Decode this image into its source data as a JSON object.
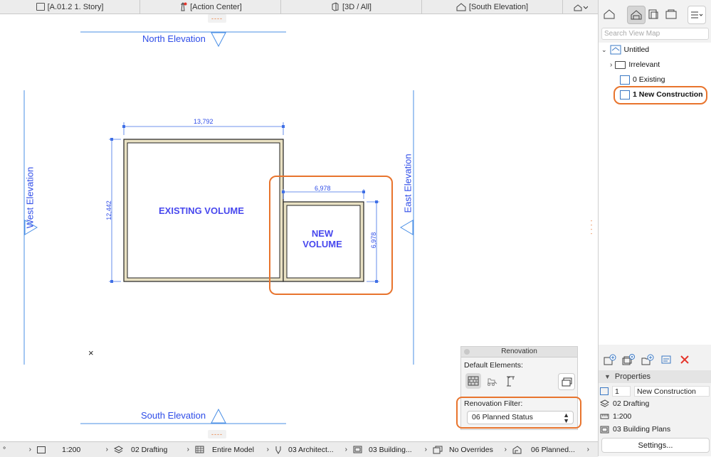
{
  "tabs": [
    {
      "label": "[A.01.2 1. Story]",
      "icon": "floor-plan-icon"
    },
    {
      "label": "[Action Center]",
      "icon": "lighthouse-icon"
    },
    {
      "label": "[3D / All]",
      "icon": "cube-icon"
    },
    {
      "label": "[South Elevation]",
      "icon": "house-elevation-icon"
    }
  ],
  "drawing": {
    "north_label": "North Elevation",
    "south_label": "South Elevation",
    "west_label": "West Elevation",
    "east_label": "East Elevation",
    "dim_top": "13,792",
    "dim_left": "12,442",
    "dim_new_top": "6,978",
    "dim_new_right": "6,978",
    "existing_label": "EXISTING VOLUME",
    "new_label_1": "NEW",
    "new_label_2": "VOLUME",
    "dashes": "----",
    "cross": "×"
  },
  "navigator": {
    "search_placeholder": "Search View Map",
    "tree": [
      {
        "label": "Untitled",
        "level": 0
      },
      {
        "label": "Irrelevant",
        "level": 1
      },
      {
        "label": "0 Existing",
        "level": 1
      },
      {
        "label": "1 New Construction",
        "level": 1,
        "selected": true
      }
    ]
  },
  "properties": {
    "header": "Properties",
    "id_value": "1",
    "name_value": "New Construction",
    "layer": "02 Drafting",
    "scale": "1:200",
    "structure": "03 Building Plans",
    "settings_button": "Settings..."
  },
  "renovation": {
    "title": "Renovation",
    "default_elements_label": "Default Elements:",
    "filter_label": "Renovation Filter:",
    "filter_value": "06 Planned Status"
  },
  "statusbar": {
    "items": [
      {
        "label": "°"
      },
      {
        "label": "1:200"
      },
      {
        "label": "02 Drafting"
      },
      {
        "label": "Entire Model"
      },
      {
        "label": "03 Architect..."
      },
      {
        "label": "03 Building..."
      },
      {
        "label": "No Overrides"
      },
      {
        "label": "06 Planned..."
      }
    ]
  },
  "colors": {
    "accent": "#e8742d",
    "blue": "#2f4de8",
    "wall": "#e9e1c3"
  }
}
